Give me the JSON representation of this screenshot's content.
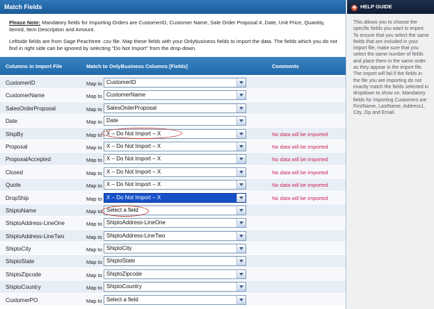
{
  "main": {
    "title": "Match Fields",
    "note_label": "Please Note:",
    "note_text": " Mandatory fields for Importing Orders are CustomerID, Customer Name, Sale Order Proposal #, Date, Unit Price, Quantity, ItemId, Item Description and Amount.",
    "leftside_text": "Leftside fields are from Sage Peachtree .csv file. Map these fields with your Onlybusiness fields to import the data. The fields which you do not find in right side can be ignored by selecting \"Do Not Import\" from the drop-down."
  },
  "columns": {
    "import_file": "Columns in Import File",
    "match_to": "Match to OnlyBusiness Columns [Fields]",
    "comments": "Comments"
  },
  "map_to_label": "Map to",
  "rows": [
    {
      "field": "CustomerID",
      "selected": "CustomerID",
      "comment": ""
    },
    {
      "field": "CustomerName",
      "selected": "CustomerName",
      "comment": ""
    },
    {
      "field": "SalesOrderProposal",
      "selected": "SalesOrderProposal",
      "comment": ""
    },
    {
      "field": "Date",
      "selected": "Date",
      "comment": ""
    },
    {
      "field": "ShipBy",
      "selected": "X – Do Not Import – X",
      "comment": "No data will be imported"
    },
    {
      "field": "Proposal",
      "selected": "X – Do Not Import – X",
      "comment": "No data will be imported"
    },
    {
      "field": "ProposalAccepted",
      "selected": "X – Do Not Import – X",
      "comment": "No data will be imported"
    },
    {
      "field": "Closed",
      "selected": "X – Do Not Import – X",
      "comment": "No data will be imported"
    },
    {
      "field": "Quote",
      "selected": "X – Do Not Import – X",
      "comment": "No data will be imported"
    },
    {
      "field": "DropShip",
      "selected": "X – Do Not Import – X",
      "comment": "No data will be imported"
    },
    {
      "field": "ShiptoName",
      "selected": "Select a field",
      "comment": ""
    },
    {
      "field": "ShiptoAddress-LineOne",
      "selected": "ShiptoAddress-LineOne",
      "comment": ""
    },
    {
      "field": "ShiptoAddress-LineTwo",
      "selected": "ShiptoAddress-LineTwo",
      "comment": ""
    },
    {
      "field": "ShiptoCity",
      "selected": "ShiptoCity",
      "comment": ""
    },
    {
      "field": "ShiptoState",
      "selected": "ShiptoState",
      "comment": ""
    },
    {
      "field": "ShiptoZipcode",
      "selected": "ShiptoZipcode",
      "comment": ""
    },
    {
      "field": "ShiptoCountry",
      "selected": "ShiptoCountry",
      "comment": ""
    },
    {
      "field": "CustomerPO",
      "selected": "Select a field",
      "comment": ""
    }
  ],
  "help": {
    "title": "HELP GUIDE",
    "icon": "help-icon",
    "text": "This allows you to choose the specific fields you want to import. To ensure that you select the same fields that are included in your import file, make sure that you select the same number of fields and place them in the same order as they appear in the import file. The import will fail if the fields in the file you are importing do not exactly match the fields selected in dropdown to show on. Mandatory fields for Importing Customers are FirstName, LastName, Address1, City, Zip and Email."
  },
  "colors": {
    "header_blue": "#216aa9",
    "row_odd": "#e8eef5",
    "row_even": "#f6f8fb",
    "comment_red": "#cc2255",
    "highlight_select": "#1450c8",
    "ellipse": "#c0392b",
    "help_bar": "#0f1c33"
  }
}
